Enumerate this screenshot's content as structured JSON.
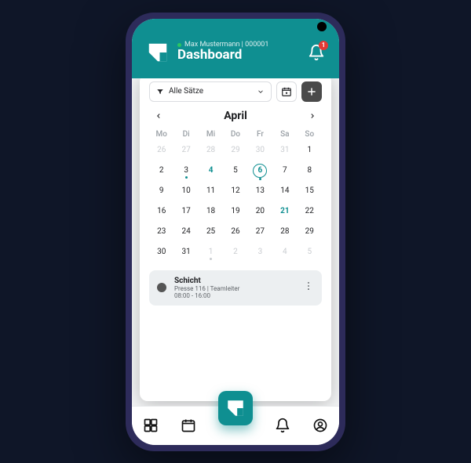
{
  "header": {
    "user_name": "Max Mustermann",
    "user_id": "000001",
    "user_line": "Max Mustermann | 000001",
    "title": "Dashboard",
    "notification_count": "1"
  },
  "toolbar": {
    "filter_label": "Alle Sätze"
  },
  "calendar": {
    "month_label": "April",
    "dow": [
      "Mo",
      "Di",
      "Mi",
      "Do",
      "Fr",
      "Sa",
      "So"
    ],
    "weeks": [
      [
        {
          "d": "26",
          "out": true
        },
        {
          "d": "27",
          "out": true
        },
        {
          "d": "28",
          "out": true
        },
        {
          "d": "29",
          "out": true
        },
        {
          "d": "30",
          "out": true
        },
        {
          "d": "31",
          "out": true
        },
        {
          "d": "1"
        }
      ],
      [
        {
          "d": "2"
        },
        {
          "d": "3",
          "dot": true
        },
        {
          "d": "4",
          "accent": true
        },
        {
          "d": "5"
        },
        {
          "d": "6",
          "selected": true,
          "dot": true
        },
        {
          "d": "7"
        },
        {
          "d": "8"
        }
      ],
      [
        {
          "d": "9"
        },
        {
          "d": "10"
        },
        {
          "d": "11"
        },
        {
          "d": "12"
        },
        {
          "d": "13"
        },
        {
          "d": "14"
        },
        {
          "d": "15"
        }
      ],
      [
        {
          "d": "16"
        },
        {
          "d": "17"
        },
        {
          "d": "18"
        },
        {
          "d": "19"
        },
        {
          "d": "20"
        },
        {
          "d": "21",
          "accent": true
        },
        {
          "d": "22"
        }
      ],
      [
        {
          "d": "23"
        },
        {
          "d": "24"
        },
        {
          "d": "25"
        },
        {
          "d": "26"
        },
        {
          "d": "27"
        },
        {
          "d": "28"
        },
        {
          "d": "29"
        }
      ],
      [
        {
          "d": "30"
        },
        {
          "d": "31"
        },
        {
          "d": "1",
          "out": true,
          "dot": true
        },
        {
          "d": "2",
          "out": true
        },
        {
          "d": "3",
          "out": true
        },
        {
          "d": "4",
          "out": true
        },
        {
          "d": "5",
          "out": true
        }
      ]
    ]
  },
  "event": {
    "title": "Schicht",
    "subtitle": "Presse 116 | Teamleiter",
    "time": "08:00 - 16:00"
  },
  "colors": {
    "brand": "#0f8f91",
    "badge": "#e53935",
    "bg_page": "#0f1628"
  }
}
